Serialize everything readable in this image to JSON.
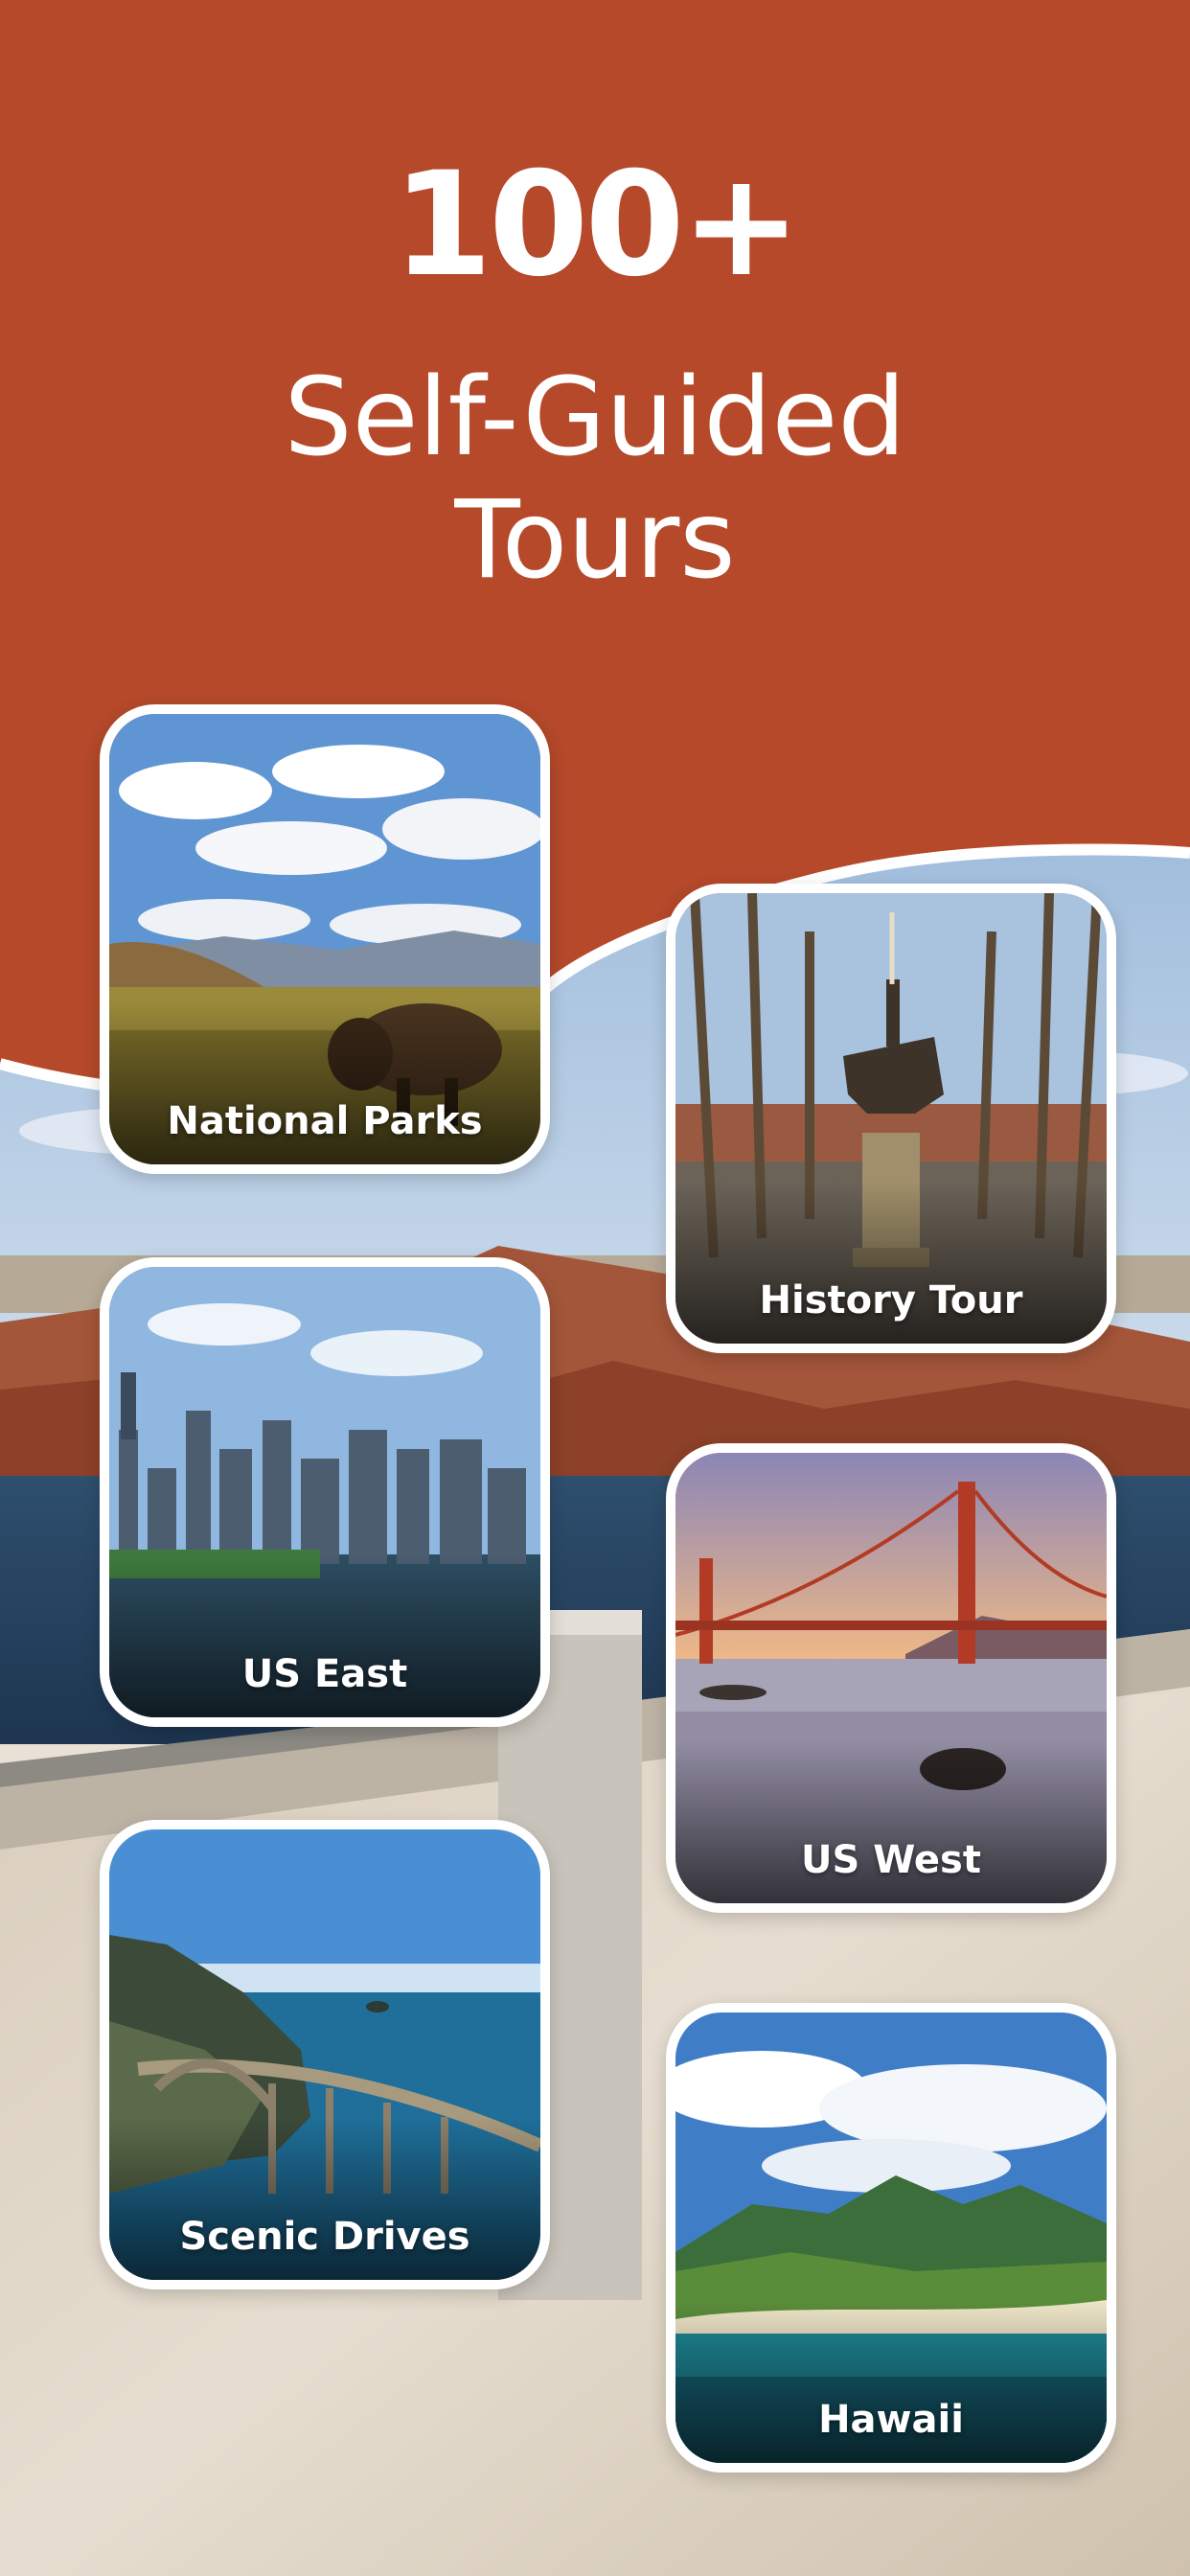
{
  "hero": {
    "count": "100+",
    "title_line1": "Self-Guided",
    "title_line2": "Tours"
  },
  "colors": {
    "header_bg": "#b5492a",
    "card_border": "#ffffff",
    "text": "#ffffff"
  },
  "cards": [
    {
      "label": "National Parks",
      "scene": "bison-prairie"
    },
    {
      "label": "History Tour",
      "scene": "equestrian-statue-park"
    },
    {
      "label": "US East",
      "scene": "city-skyline"
    },
    {
      "label": "US West",
      "scene": "golden-gate-bridge"
    },
    {
      "label": "Scenic Drives",
      "scene": "coastal-bridge"
    },
    {
      "label": "Hawaii",
      "scene": "tropical-mountain-coast"
    }
  ]
}
